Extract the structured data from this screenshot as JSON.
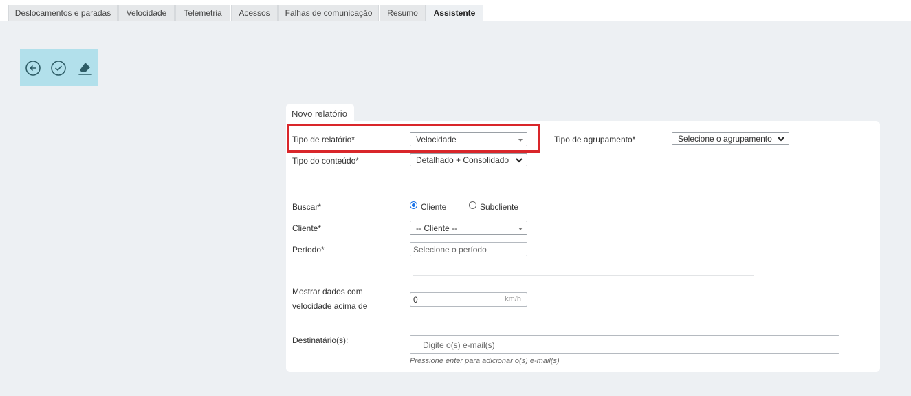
{
  "tabs": [
    {
      "label": "Deslocamentos e paradas"
    },
    {
      "label": "Velocidade"
    },
    {
      "label": "Telemetria"
    },
    {
      "label": "Acessos"
    },
    {
      "label": "Falhas de comunicação"
    },
    {
      "label": "Resumo"
    },
    {
      "label": "Assistente"
    }
  ],
  "active_tab": "Assistente",
  "toolbar": {
    "icons": [
      "back-icon",
      "check-icon",
      "eraser-icon"
    ],
    "color": "#b2e0eb"
  },
  "panel": {
    "title": "Novo relatório"
  },
  "form": {
    "report_type": {
      "label": "Tipo de relatório*",
      "value": "Velocidade"
    },
    "grouping_type": {
      "label": "Tipo de agrupamento*",
      "value": "Selecione o agrupamento"
    },
    "content_type": {
      "label": "Tipo do conteúdo*",
      "value": "Detalhado + Consolidado"
    },
    "search": {
      "label": "Buscar*",
      "options": [
        "Cliente",
        "Subcliente"
      ],
      "selected": "Cliente"
    },
    "client": {
      "label": "Cliente*",
      "value": "-- Cliente --"
    },
    "period": {
      "label": "Período*",
      "placeholder": "Selecione o período"
    },
    "speed": {
      "label_line1": "Mostrar dados com",
      "label_line2": "velocidade acima de",
      "value": "0",
      "unit": "km/h"
    },
    "recipients": {
      "label": "Destinatário(s):",
      "placeholder": "Digite o(s) e-mail(s)",
      "hint": "Pressione enter para adicionar o(s) e-mail(s)"
    }
  },
  "colors": {
    "highlight": "#d9262a",
    "toolbar_bg": "#b2e0eb",
    "radio_selected": "#1a73e8",
    "page_bg": "#edf0f3"
  }
}
